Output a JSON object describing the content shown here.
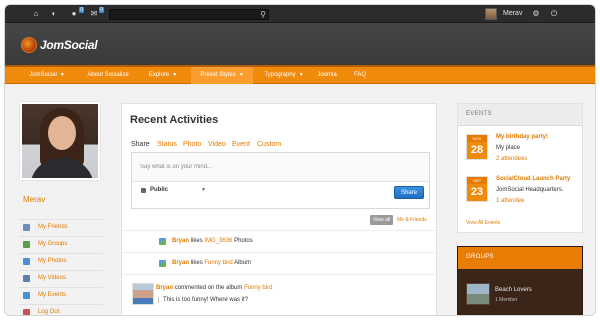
{
  "toolbar": {
    "notif_friends_count": "0",
    "notif_messages_count": "0",
    "search_placeholder": "",
    "username": "Merav"
  },
  "brand": {
    "logo_text": "JomSocial"
  },
  "nav": {
    "items": [
      {
        "label": "JomSocial",
        "has_caret": true
      },
      {
        "label": "About Socialize",
        "has_caret": false
      },
      {
        "label": "Explore",
        "has_caret": true
      },
      {
        "label": "Preset Styles",
        "has_caret": true,
        "active": true
      },
      {
        "label": "Typography",
        "has_caret": true
      },
      {
        "label": "Joomla",
        "has_caret": false
      },
      {
        "label": "FAQ",
        "has_caret": false
      }
    ]
  },
  "profile": {
    "name": "Merav",
    "menu": [
      {
        "label": "My Friends",
        "icon": "friends-icon",
        "color": "#6a8fbf"
      },
      {
        "label": "My Groups",
        "icon": "groups-icon",
        "color": "#5b9d48"
      },
      {
        "label": "My Photos",
        "icon": "photos-icon",
        "color": "#4f8fd0"
      },
      {
        "label": "My Videos",
        "icon": "videos-icon",
        "color": "#5f7fb0"
      },
      {
        "label": "My Events",
        "icon": "events-icon",
        "color": "#4a8fcf"
      },
      {
        "label": "Log Out",
        "icon": "logout-icon",
        "color": "#d05050"
      }
    ]
  },
  "activities": {
    "title": "Recent Activities",
    "tabs": [
      "Share",
      "Status",
      "Photo",
      "Video",
      "Event",
      "Custom"
    ],
    "composer_placeholder": "Say what is on your mind...",
    "privacy": "Public",
    "share_label": "Share",
    "filter_all": "View all",
    "filter_friends": "Me & Friends",
    "items": [
      {
        "user": "Bryan",
        "verb": "likes",
        "object": "IMG_3636",
        "suffix": "Photos"
      },
      {
        "user": "Bryan",
        "verb": "likes",
        "object": "Funny bird",
        "suffix": "Album"
      }
    ],
    "comment": {
      "user": "Bryan",
      "text": "commented on the album",
      "album": "Funny bird",
      "quote": "This is too funny! Where was it?"
    }
  },
  "events": {
    "heading": "EVENTS",
    "items": [
      {
        "month": "NOV",
        "day": "28",
        "title": "My birthday party!",
        "place": "My place",
        "attendees": "2 attendees"
      },
      {
        "month": "SEP",
        "day": "23",
        "title": "SocialCloud Launch Party",
        "place": "JomSocial Headquarters.",
        "attendees": "1 attendee"
      }
    ],
    "view_all": "View All Events"
  },
  "groups": {
    "heading": "GROUPS",
    "items": [
      {
        "name": "Beach Lovers",
        "members": "1 Member"
      }
    ]
  }
}
